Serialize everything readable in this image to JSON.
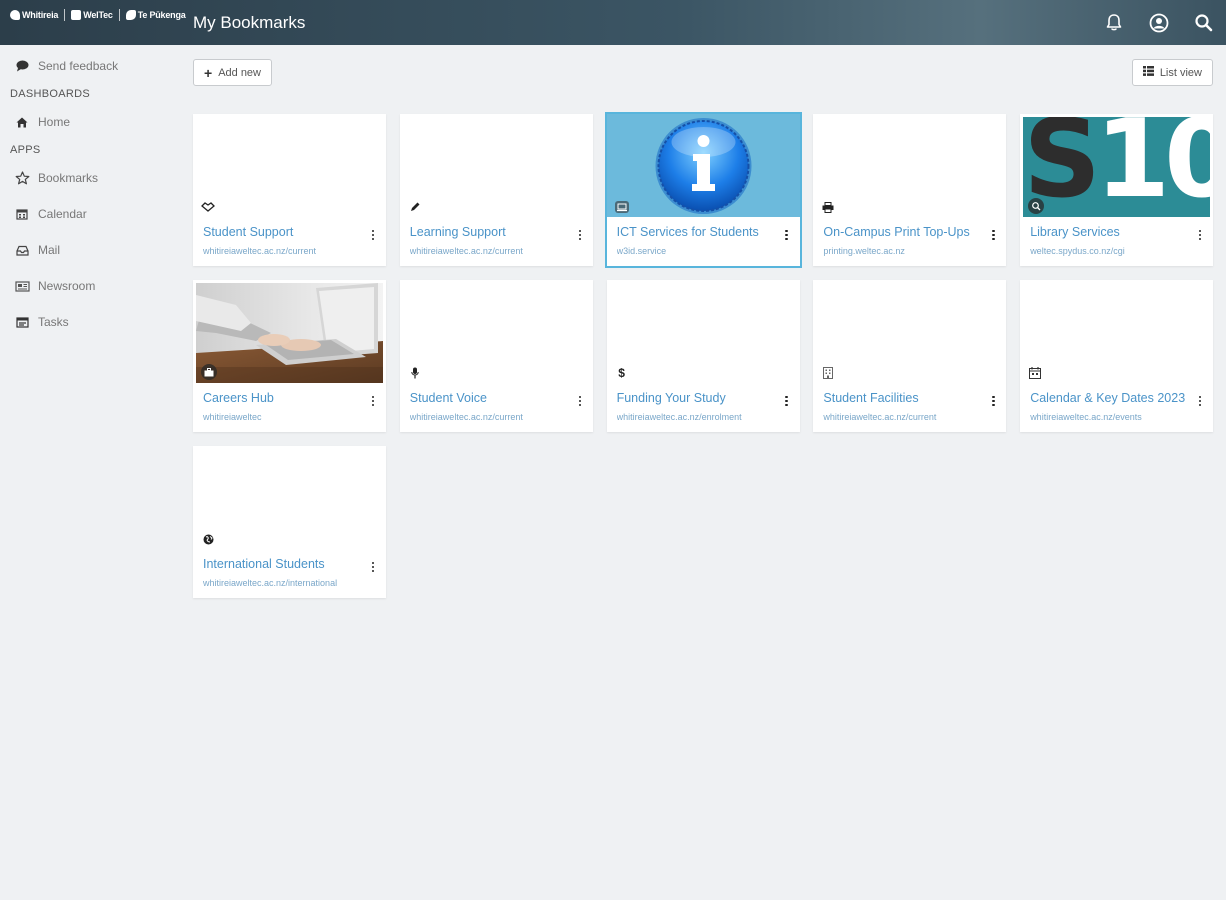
{
  "header": {
    "title": "My Bookmarks",
    "logos": [
      "Whitireia",
      "WelTec",
      "Te Pūkenga"
    ],
    "icons": [
      "bell-icon",
      "user-circle-icon",
      "search-icon"
    ]
  },
  "sidebar": {
    "feedback": "Send feedback",
    "dashboards_heading": "DASHBOARDS",
    "home": "Home",
    "apps_heading": "APPS",
    "apps": [
      {
        "label": "Bookmarks",
        "icon": "star-icon"
      },
      {
        "label": "Calendar",
        "icon": "calendar-icon"
      },
      {
        "label": "Mail",
        "icon": "inbox-icon"
      },
      {
        "label": "Newsroom",
        "icon": "newspaper-icon"
      },
      {
        "label": "Tasks",
        "icon": "tasks-icon"
      }
    ]
  },
  "toolbar": {
    "add_label": "Add new",
    "list_view_label": "List view"
  },
  "bookmarks": [
    {
      "title": "Student Support",
      "url": "whitireiaweltec.ac.nz/current",
      "icon": "heart-hands-icon"
    },
    {
      "title": "Learning Support",
      "url": "whitireiaweltec.ac.nz/current",
      "icon": "pencil-icon"
    },
    {
      "title": "ICT Services for Students",
      "url": "w3id.service",
      "icon": "laptop-icon"
    },
    {
      "title": "On-Campus Print Top-Ups",
      "url": "printing.weltec.ac.nz",
      "icon": "printer-icon"
    },
    {
      "title": "Library Services",
      "url": "weltec.spydus.co.nz/cgi",
      "icon": "search-book-icon",
      "thumb_text": "S10"
    },
    {
      "title": "Careers Hub",
      "url": "whitireiaweltec",
      "icon": "briefcase-icon"
    },
    {
      "title": "Student Voice",
      "url": "whitireiaweltec.ac.nz/current",
      "icon": "microphone-icon"
    },
    {
      "title": "Funding Your Study",
      "url": "whitireiaweltec.ac.nz/enrolment",
      "icon": "dollar-icon"
    },
    {
      "title": "Student Facilities",
      "url": "whitireiaweltec.ac.nz/current",
      "icon": "building-icon"
    },
    {
      "title": "Calendar & Key Dates 2023",
      "url": "whitireiaweltec.ac.nz/events",
      "icon": "calendar-icon"
    },
    {
      "title": "International Students",
      "url": "whitireiaweltec.ac.nz/international",
      "icon": "globe-icon"
    }
  ],
  "colors": {
    "header": "#3b5564",
    "link": "#4a93c8",
    "url": "#7aa7c9",
    "selected_border": "#58b5dc",
    "ict_thumb_bg": "#6cbadc",
    "library_thumb_bg": "#2c8c96"
  }
}
